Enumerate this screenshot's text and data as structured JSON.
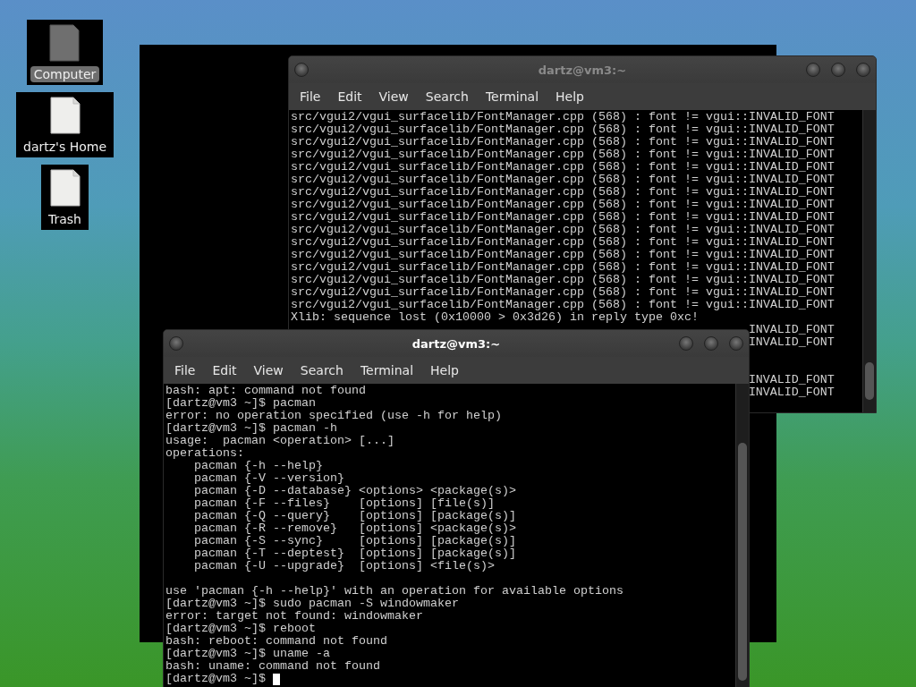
{
  "desktop_icons": [
    {
      "label": "Computer",
      "kind": "computer",
      "selected": true
    },
    {
      "label": "dartz's Home",
      "kind": "document",
      "selected": false
    },
    {
      "label": "Trash",
      "kind": "document",
      "selected": false
    }
  ],
  "windows": [
    {
      "kind": "blank"
    },
    {
      "kind": "terminal",
      "title": "dartz@vm3:~",
      "active": false,
      "menu": [
        "File",
        "Edit",
        "View",
        "Search",
        "Terminal",
        "Help"
      ],
      "cursor": false,
      "lines": [
        {
          "kind": "full",
          "text": "src/vgui2/vgui_surfacelib/FontManager.cpp (568) : font != vgui::INVALID_FONT"
        },
        {
          "kind": "full",
          "text": "src/vgui2/vgui_surfacelib/FontManager.cpp (568) : font != vgui::INVALID_FONT"
        },
        {
          "kind": "full",
          "text": "src/vgui2/vgui_surfacelib/FontManager.cpp (568) : font != vgui::INVALID_FONT"
        },
        {
          "kind": "full",
          "text": "src/vgui2/vgui_surfacelib/FontManager.cpp (568) : font != vgui::INVALID_FONT"
        },
        {
          "kind": "full",
          "text": "src/vgui2/vgui_surfacelib/FontManager.cpp (568) : font != vgui::INVALID_FONT"
        },
        {
          "kind": "full",
          "text": "src/vgui2/vgui_surfacelib/FontManager.cpp (568) : font != vgui::INVALID_FONT"
        },
        {
          "kind": "full",
          "text": "src/vgui2/vgui_surfacelib/FontManager.cpp (568) : font != vgui::INVALID_FONT"
        },
        {
          "kind": "full",
          "text": "src/vgui2/vgui_surfacelib/FontManager.cpp (568) : font != vgui::INVALID_FONT"
        },
        {
          "kind": "full",
          "text": "src/vgui2/vgui_surfacelib/FontManager.cpp (568) : font != vgui::INVALID_FONT"
        },
        {
          "kind": "full",
          "text": "src/vgui2/vgui_surfacelib/FontManager.cpp (568) : font != vgui::INVALID_FONT"
        },
        {
          "kind": "full",
          "text": "src/vgui2/vgui_surfacelib/FontManager.cpp (568) : font != vgui::INVALID_FONT"
        },
        {
          "kind": "full",
          "text": "src/vgui2/vgui_surfacelib/FontManager.cpp (568) : font != vgui::INVALID_FONT"
        },
        {
          "kind": "full",
          "text": "src/vgui2/vgui_surfacelib/FontManager.cpp (568) : font != vgui::INVALID_FONT"
        },
        {
          "kind": "full",
          "text": "src/vgui2/vgui_surfacelib/FontManager.cpp (568) : font != vgui::INVALID_FONT"
        },
        {
          "kind": "full",
          "text": "src/vgui2/vgui_surfacelib/FontManager.cpp (568) : font != vgui::INVALID_FONT"
        },
        {
          "kind": "full",
          "text": "src/vgui2/vgui_surfacelib/FontManager.cpp (568) : font != vgui::INVALID_FONT"
        },
        {
          "kind": "full",
          "text": "Xlib: sequence lost (0x10000 > 0x3d26) in reply type 0xc!"
        },
        {
          "kind": "tail",
          "text": "INVALID_FONT"
        },
        {
          "kind": "tail",
          "text": "INVALID_FONT"
        },
        {
          "kind": "covered"
        },
        {
          "kind": "covered"
        },
        {
          "kind": "tail",
          "text": "INVALID_FONT"
        },
        {
          "kind": "tail",
          "text": "INVALID_FONT"
        }
      ]
    },
    {
      "kind": "terminal",
      "title": "dartz@vm3:~",
      "active": true,
      "menu": [
        "File",
        "Edit",
        "View",
        "Search",
        "Terminal",
        "Help"
      ],
      "cursor": true,
      "lines": [
        {
          "kind": "full",
          "text": "bash: apt: command not found"
        },
        {
          "kind": "full",
          "text": "[dartz@vm3 ~]$ pacman"
        },
        {
          "kind": "full",
          "text": "error: no operation specified (use -h for help)"
        },
        {
          "kind": "full",
          "text": "[dartz@vm3 ~]$ pacman -h"
        },
        {
          "kind": "full",
          "text": "usage:  pacman <operation> [...]"
        },
        {
          "kind": "full",
          "text": "operations:"
        },
        {
          "kind": "full",
          "text": "    pacman {-h --help}"
        },
        {
          "kind": "full",
          "text": "    pacman {-V --version}"
        },
        {
          "kind": "full",
          "text": "    pacman {-D --database} <options> <package(s)>"
        },
        {
          "kind": "full",
          "text": "    pacman {-F --files}    [options] [file(s)]"
        },
        {
          "kind": "full",
          "text": "    pacman {-Q --query}    [options] [package(s)]"
        },
        {
          "kind": "full",
          "text": "    pacman {-R --remove}   [options] <package(s)>"
        },
        {
          "kind": "full",
          "text": "    pacman {-S --sync}     [options] [package(s)]"
        },
        {
          "kind": "full",
          "text": "    pacman {-T --deptest}  [options] [package(s)]"
        },
        {
          "kind": "full",
          "text": "    pacman {-U --upgrade}  [options] <file(s)>"
        },
        {
          "kind": "covered"
        },
        {
          "kind": "full",
          "text": "use 'pacman {-h --help}' with an operation for available options"
        },
        {
          "kind": "full",
          "text": "[dartz@vm3 ~]$ sudo pacman -S windowmaker"
        },
        {
          "kind": "full",
          "text": "error: target not found: windowmaker"
        },
        {
          "kind": "full",
          "text": "[dartz@vm3 ~]$ reboot"
        },
        {
          "kind": "full",
          "text": "bash: reboot: command not found"
        },
        {
          "kind": "full",
          "text": "[dartz@vm3 ~]$ uname -a"
        },
        {
          "kind": "full",
          "text": "bash: uname: command not found"
        },
        {
          "kind": "full",
          "text": "[dartz@vm3 ~]$"
        }
      ]
    }
  ]
}
